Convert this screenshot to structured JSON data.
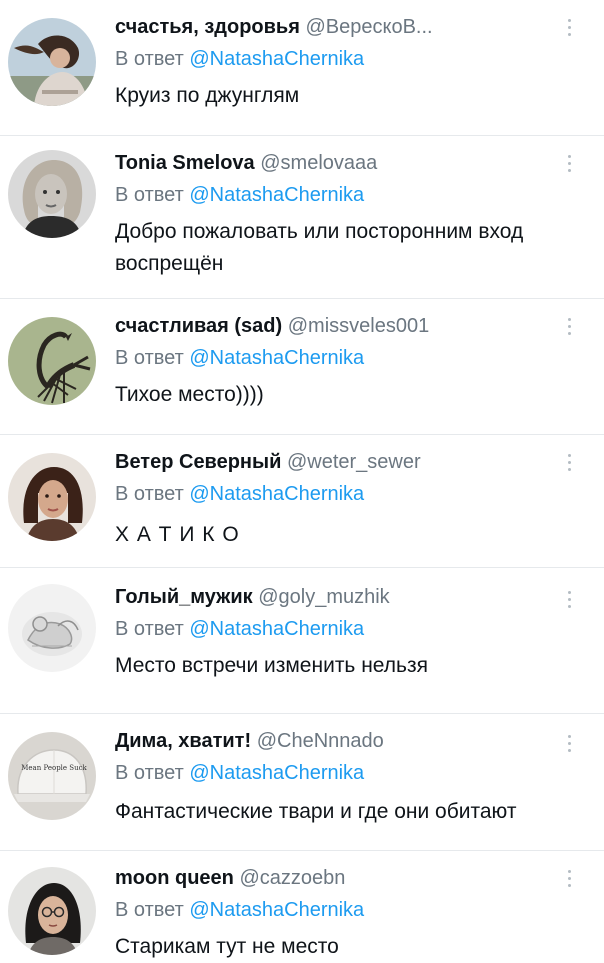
{
  "reply_prefix": "В ответ",
  "replies": [
    {
      "name": "счастья, здоровья",
      "handle": "@ВерескоВ...",
      "mention": "@NatashaChernika",
      "text": "Круиз по джунглям",
      "avatar": "avatar-woman-hair-blowing"
    },
    {
      "name": "Tonia Smelova",
      "handle": "@smelovaaa",
      "mention": "@NatashaChernika",
      "text": "Добро пожаловать или посторонним вход воспрещён",
      "avatar": "avatar-woman-portrait-bw"
    },
    {
      "name": "счастливая (sad)",
      "handle": "@missveles001",
      "mention": "@NatashaChernika",
      "text": "Тихое место))))",
      "avatar": "avatar-scorpion"
    },
    {
      "name": "Ветер Северный",
      "handle": "@weter_sewer",
      "mention": "@NatashaChernika",
      "text": "Х А Т И К О",
      "avatar": "avatar-woman-dark-hair"
    },
    {
      "name": "Голый_мужик",
      "handle": "@goly_muzhik",
      "mention": "@NatashaChernika",
      "text": "Место встречи изменить нельзя",
      "avatar": "avatar-sketch-figure"
    },
    {
      "name": "Дима, хватит!",
      "handle": "@CheNnnado",
      "mention": "@NatashaChernika",
      "text": "Фантастические твари и где они обитают",
      "avatar": "avatar-white-cap",
      "avatar_caption": "Mean People Suck"
    },
    {
      "name": "moon queen",
      "handle": "@cazzoebn",
      "mention": "@NatashaChernika",
      "text": "Старикам тут не место",
      "avatar": "avatar-woman-glasses"
    }
  ]
}
